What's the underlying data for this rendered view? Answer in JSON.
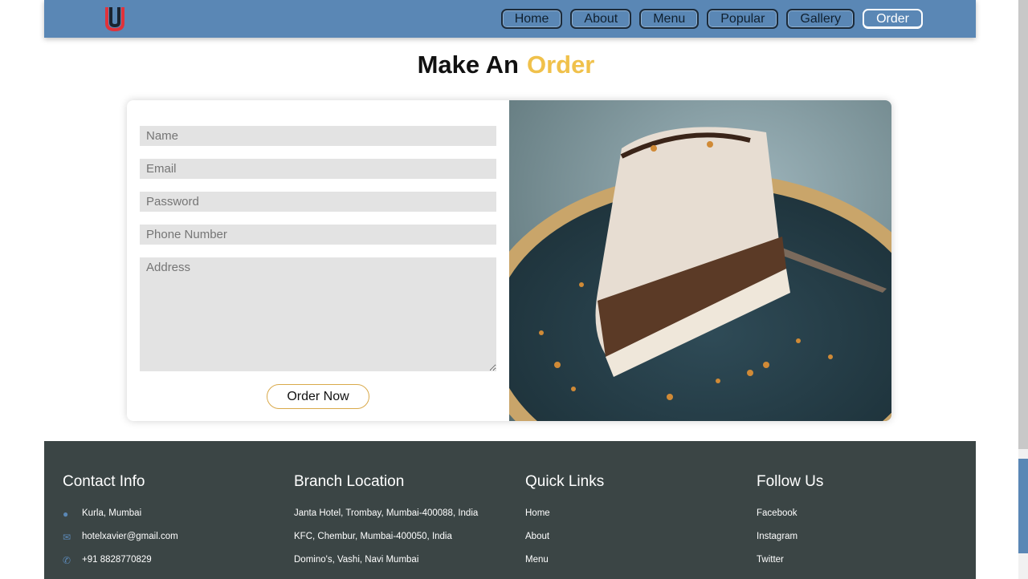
{
  "nav": {
    "items": [
      {
        "label": "Home"
      },
      {
        "label": "About"
      },
      {
        "label": "Menu"
      },
      {
        "label": "Popular"
      },
      {
        "label": "Gallery"
      },
      {
        "label": "Order",
        "active": true
      }
    ]
  },
  "title": {
    "main": "Make An",
    "accent": "Order"
  },
  "form": {
    "name_placeholder": "Name",
    "email_placeholder": "Email",
    "password_placeholder": "Password",
    "phone_placeholder": "Phone Number",
    "address_placeholder": "Address",
    "submit_label": "Order Now"
  },
  "footer": {
    "contact": {
      "heading": "Contact Info",
      "items": [
        {
          "icon": "map-pin-icon",
          "text": "Kurla, Mumbai"
        },
        {
          "icon": "envelope-icon",
          "text": "hotelxavier@gmail.com"
        },
        {
          "icon": "phone-icon",
          "text": "+91 8828770829"
        }
      ]
    },
    "branch": {
      "heading": "Branch Location",
      "items": [
        "Janta Hotel, Trombay, Mumbai-400088, India",
        "KFC, Chembur, Mumbai-400050, India",
        "Domino's, Vashi, Navi Mumbai"
      ]
    },
    "links": {
      "heading": "Quick Links",
      "items": [
        "Home",
        "About",
        "Menu"
      ]
    },
    "follow": {
      "heading": "Follow Us",
      "items": [
        "Facebook",
        "Instagram",
        "Twitter"
      ]
    }
  },
  "colors": {
    "header": "#5a87b5",
    "accent": "#f0c14b",
    "footer": "#3b4545"
  }
}
